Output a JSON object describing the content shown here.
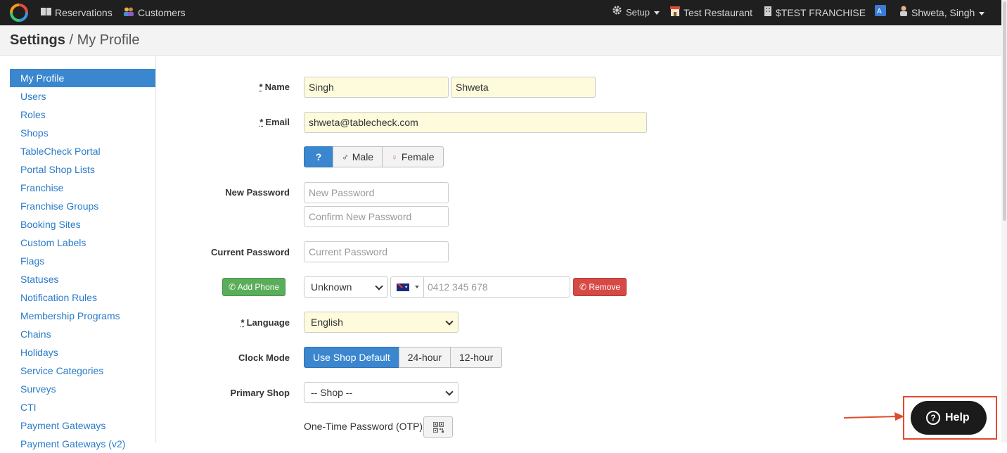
{
  "nav": {
    "reservations": "Reservations",
    "customers": "Customers",
    "setup": "Setup",
    "restaurant": "Test Restaurant",
    "franchise": "$TEST FRANCHISE",
    "user": "Shweta, Singh"
  },
  "breadcrumb": {
    "section": "Settings",
    "separator": "/",
    "page": "My Profile"
  },
  "sidebar": {
    "items": [
      {
        "label": "My Profile",
        "active": true
      },
      {
        "label": "Users"
      },
      {
        "label": "Roles"
      },
      {
        "label": "Shops"
      },
      {
        "label": "TableCheck Portal"
      },
      {
        "label": "Portal Shop Lists"
      },
      {
        "label": "Franchise"
      },
      {
        "label": "Franchise Groups"
      },
      {
        "label": "Booking Sites"
      },
      {
        "label": "Custom Labels"
      },
      {
        "label": "Flags"
      },
      {
        "label": "Statuses"
      },
      {
        "label": "Notification Rules"
      },
      {
        "label": "Membership Programs"
      },
      {
        "label": "Chains"
      },
      {
        "label": "Holidays"
      },
      {
        "label": "Service Categories"
      },
      {
        "label": "Surveys"
      },
      {
        "label": "CTI"
      },
      {
        "label": "Payment Gateways"
      },
      {
        "label": "Payment Gateways (v2)"
      }
    ]
  },
  "form": {
    "required_mark": "*",
    "name": {
      "label": "Name",
      "last_name": "Singh",
      "first_name": "Shweta"
    },
    "email": {
      "label": "Email",
      "value": "shweta@tablecheck.com"
    },
    "gender": {
      "unknown": "?",
      "male": "Male",
      "female": "Female",
      "selected": "?"
    },
    "new_password": {
      "label": "New Password",
      "placeholder": "New Password",
      "confirm_placeholder": "Confirm New Password"
    },
    "current_password": {
      "label": "Current Password",
      "placeholder": "Current Password"
    },
    "phone": {
      "add_label": "Add Phone",
      "type": "Unknown",
      "placeholder": "0412 345 678",
      "remove_label": "Remove",
      "country": "AU"
    },
    "language": {
      "label": "Language",
      "value": "English"
    },
    "clock_mode": {
      "label": "Clock Mode",
      "options": [
        "Use Shop Default",
        "24-hour",
        "12-hour"
      ],
      "selected": "Use Shop Default"
    },
    "primary_shop": {
      "label": "Primary Shop",
      "value": "-- Shop --"
    },
    "otp": {
      "label": "One-Time Password (OTP)"
    }
  },
  "help": {
    "label": "Help"
  },
  "colors": {
    "accent": "#3a86cf",
    "navbar": "#1f1f1f",
    "highlight": "#e04b2f",
    "required_bg": "#fdfbdc"
  }
}
